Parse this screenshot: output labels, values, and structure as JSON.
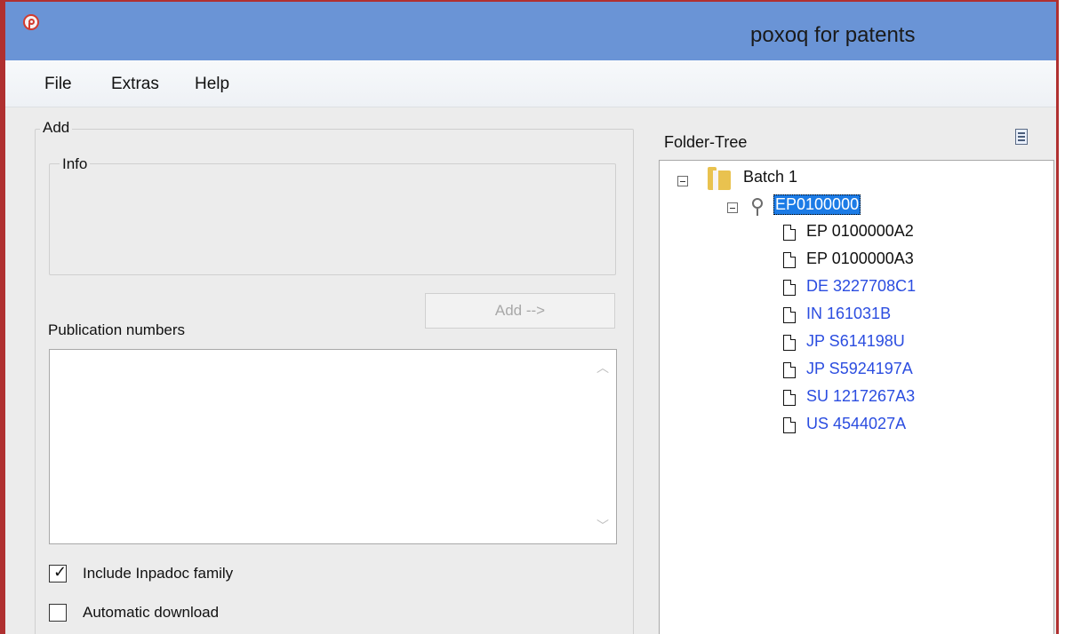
{
  "window": {
    "title": "poxoq for patents"
  },
  "menu": {
    "items": [
      "File",
      "Extras",
      "Help"
    ]
  },
  "left": {
    "add_group_label": "Add",
    "info_group_label": "Info",
    "add_button_label": "Add -->",
    "publication_numbers_label": "Publication numbers",
    "publication_numbers_value": "",
    "checkboxes": [
      {
        "label": "Include Inpadoc family",
        "checked": true
      },
      {
        "label": "Automatic download",
        "checked": false
      }
    ]
  },
  "right": {
    "tree_title": "Folder-Tree",
    "tree": {
      "root": {
        "label": "Batch 1",
        "icon": "folder-icon"
      },
      "child": {
        "label": "EP0100000",
        "icon": "search-icon",
        "selected": true
      },
      "items": [
        {
          "label": "EP 0100000A2",
          "color": "#111111"
        },
        {
          "label": "EP 0100000A3",
          "color": "#111111"
        },
        {
          "label": "DE 3227708C1",
          "color": "#2b4de0"
        },
        {
          "label": "IN 161031B",
          "color": "#2b4de0"
        },
        {
          "label": "JP S614198U",
          "color": "#2b4de0"
        },
        {
          "label": "JP S5924197A",
          "color": "#2b4de0"
        },
        {
          "label": "SU 1217267A3",
          "color": "#2b4de0"
        },
        {
          "label": "US 4544027A",
          "color": "#2b4de0"
        }
      ]
    }
  }
}
